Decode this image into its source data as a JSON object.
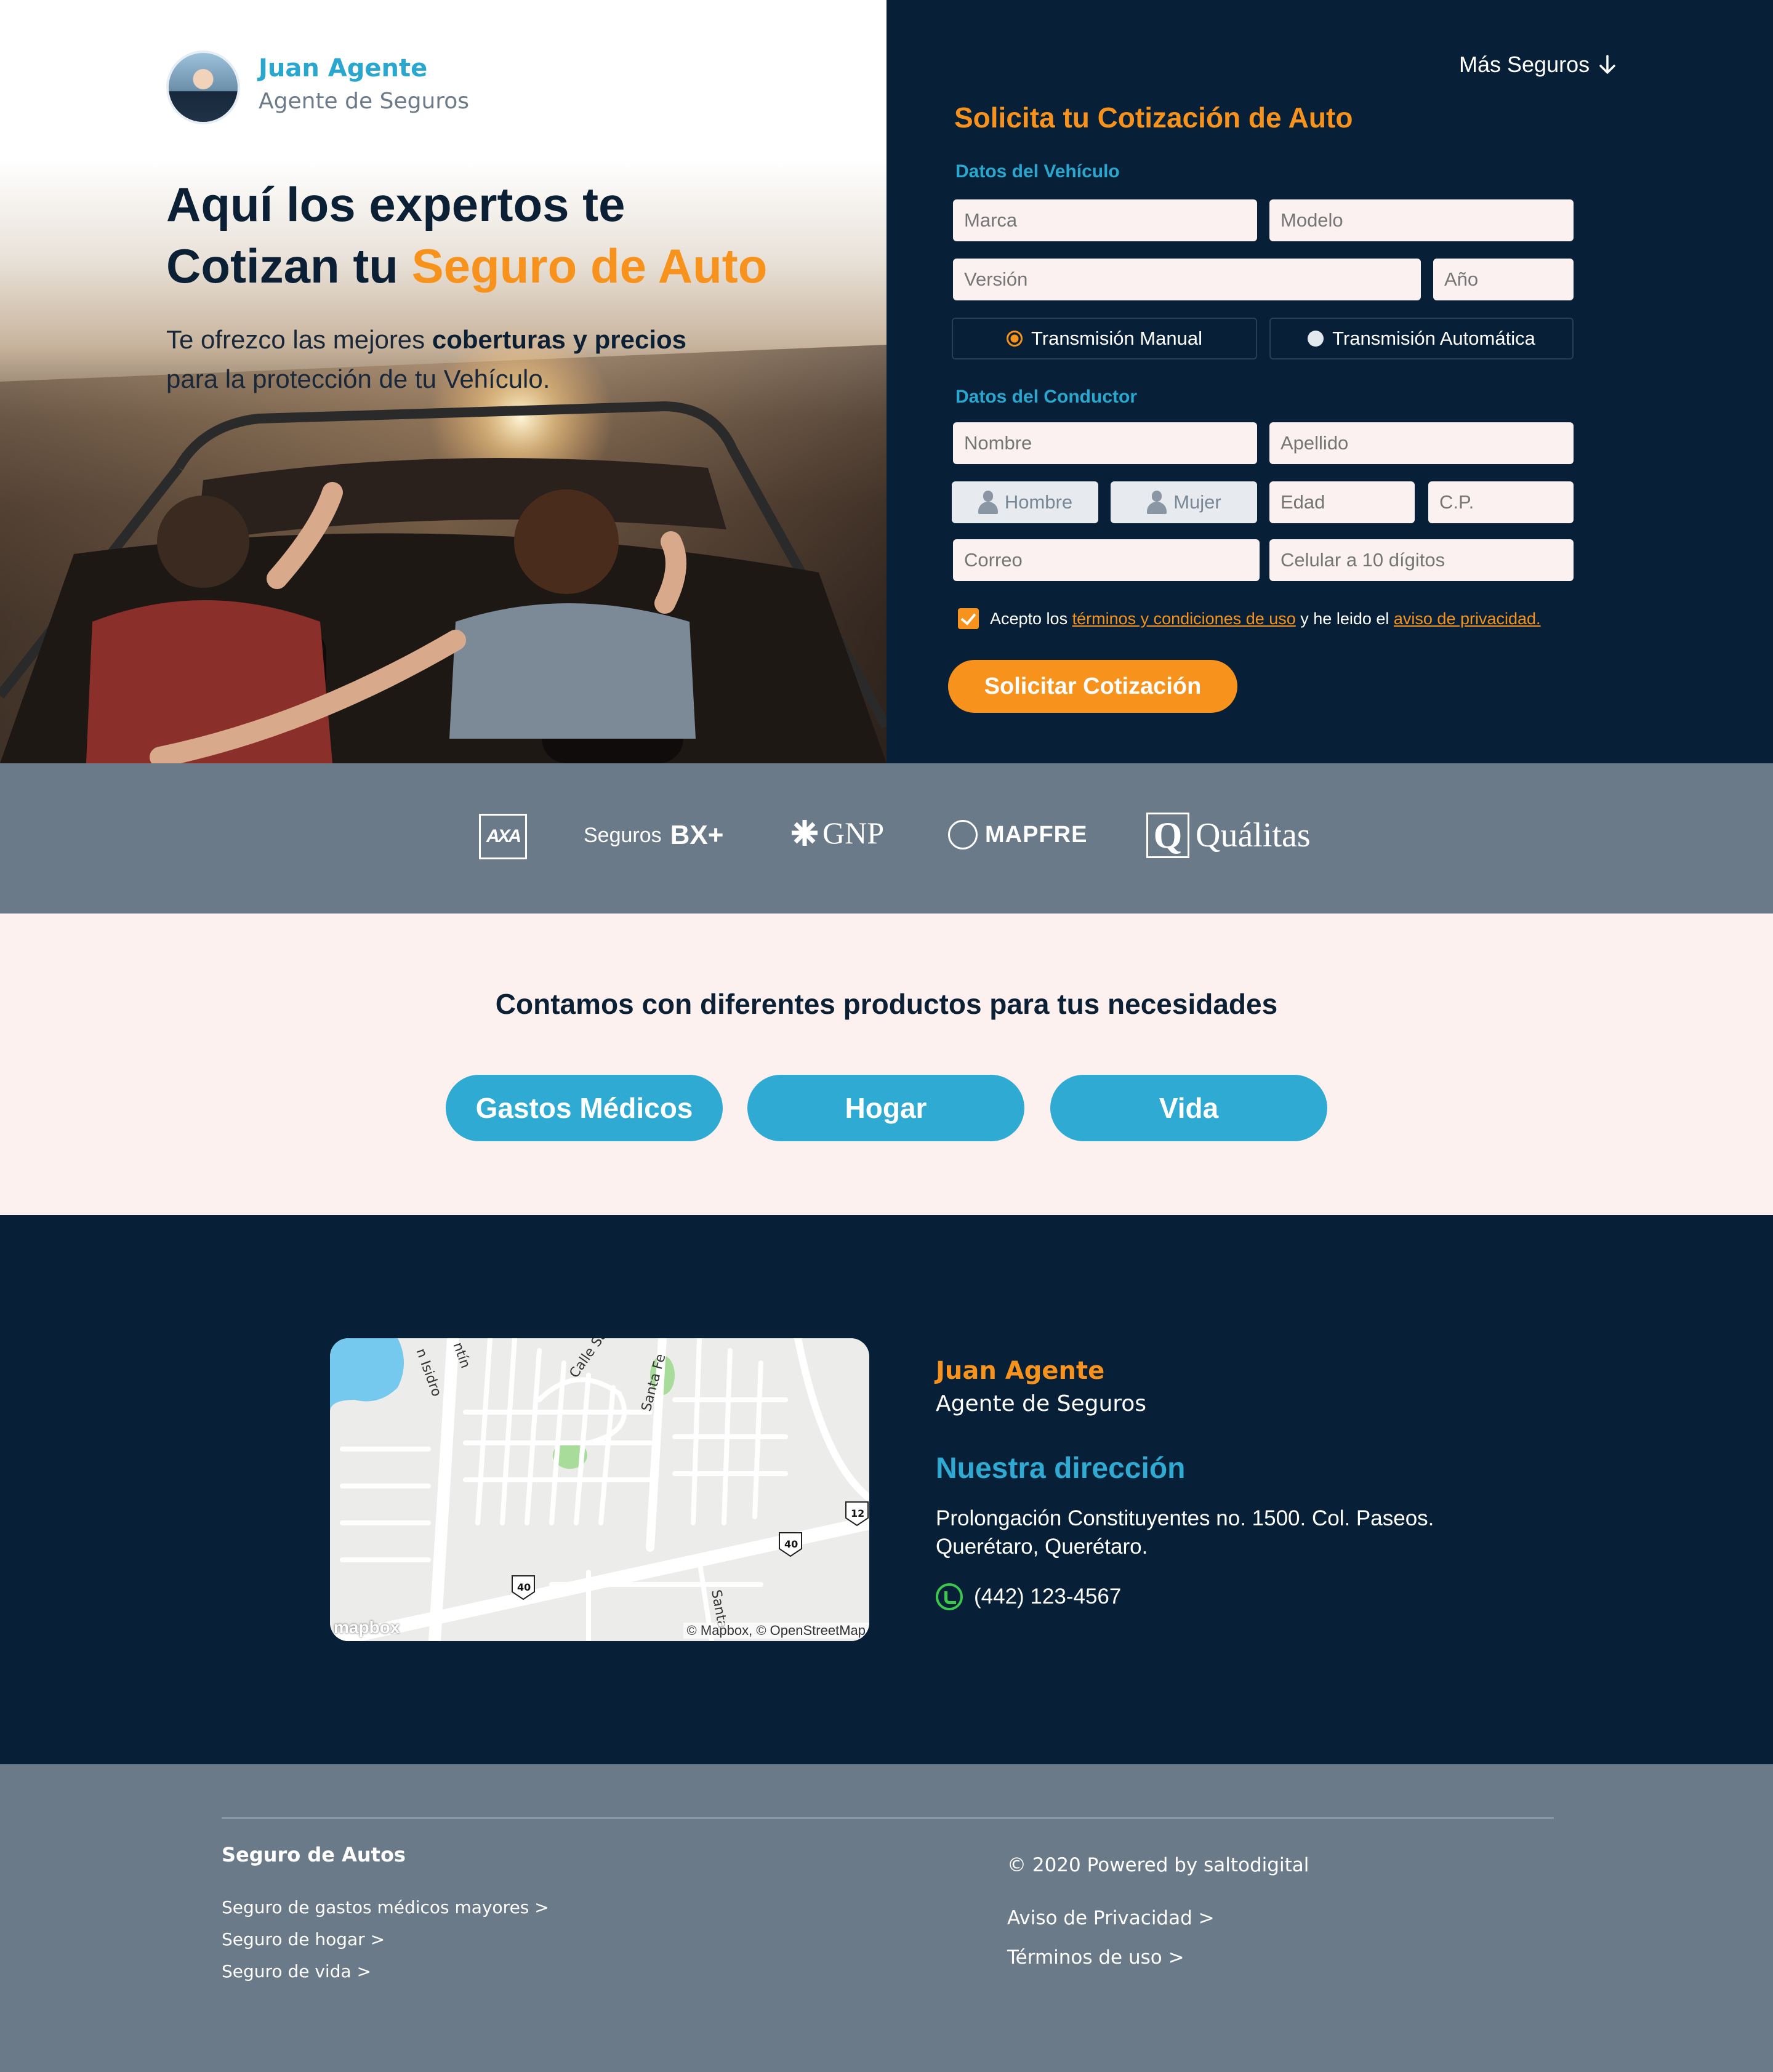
{
  "agent": {
    "name": "Juan Agente",
    "role": "Agente de Seguros"
  },
  "hero": {
    "title_line1": "Aquí los expertos te",
    "title_line2_prefix": "Cotizan tu ",
    "title_line2_accent": "Seguro de Auto",
    "sub_prefix": "Te ofrezco las mejores ",
    "sub_bold": "coberturas y precios",
    "sub_line2": "para la protección de tu Vehículo."
  },
  "nav": {
    "more_label": "Más Seguros",
    "more_icon": "arrow-down-icon"
  },
  "form": {
    "title": "Solicita tu Cotización de Auto",
    "vehicle_label": "Datos del Vehículo",
    "driver_label": "Datos del Conductor",
    "placeholders": {
      "marca": "Marca",
      "modelo": "Modelo",
      "version": "Versión",
      "anio": "Año",
      "nombre": "Nombre",
      "apellido": "Apellido",
      "edad": "Edad",
      "cp": "C.P.",
      "correo": "Correo",
      "celular": "Celular a 10 dígitos"
    },
    "transmission": {
      "manual": "Transmisión Manual",
      "automatic": "Transmisión Automática",
      "selected": "manual"
    },
    "gender": {
      "male": "Hombre",
      "female": "Mujer"
    },
    "accept": {
      "prefix": "Acepto los ",
      "terms_link": "términos y condiciones de uso",
      "middle": " y he leido el ",
      "privacy_link": "aviso de privacidad.",
      "checked": true
    },
    "submit": "Solicitar Cotización"
  },
  "insurers": {
    "axa": "AXA",
    "bx_prefix": "Seguros",
    "bx_mark": "BX+",
    "gnp": "GNP",
    "mapfre": "MAPFRE",
    "qualitas_mark": "Q",
    "qualitas": "Quálitas"
  },
  "products": {
    "title": "Contamos con diferentes productos para tus necesidades",
    "items": [
      "Gastos Médicos",
      "Hogar",
      "Vida"
    ]
  },
  "contact": {
    "name": "Juan Agente",
    "role": "Agente de Seguros",
    "address_title": "Nuestra dirección",
    "address_line1": "Prolongación Constituyentes no. 1500. Col. Paseos.",
    "address_line2": "Querétaro, Querétaro.",
    "phone": "(442) 123-4567",
    "map": {
      "logo": "mapbox",
      "attribution": "© Mapbox, © OpenStreetMap",
      "labels": [
        "Calle Sa",
        "Santa Fe",
        "n Isidro",
        "ntín",
        "Santa"
      ],
      "shields": [
        "12",
        "40",
        "40"
      ]
    }
  },
  "footer": {
    "heading": "Seguro de Autos",
    "links": [
      "Seguro de gastos médicos mayores >",
      "Seguro de hogar >",
      "Seguro de vida >"
    ],
    "copyright": "© 2020 Powered by saltodigital",
    "privacy": "Aviso de Privacidad >",
    "terms": "Términos de uso >"
  },
  "colors": {
    "accent": "#f7931d",
    "brand_blue": "#2eaad3",
    "navy": "#072037",
    "slate": "#6a7a88",
    "blush": "#fcf1ef"
  }
}
